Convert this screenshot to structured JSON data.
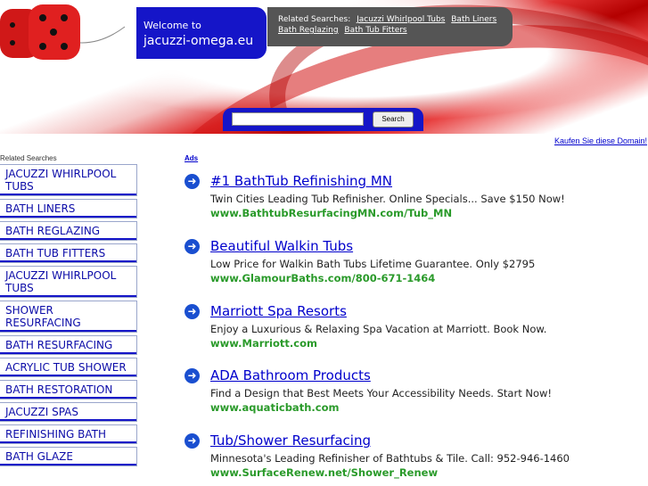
{
  "header": {
    "welcome_label": "Welcome to",
    "domain": "jacuzzi-omega.eu",
    "related_label": "Related Searches:",
    "related_links": [
      "Jacuzzi Whirlpool Tubs",
      "Bath Liners",
      "Bath Reglazing",
      "Bath Tub Fitters"
    ]
  },
  "search": {
    "button_label": "Search",
    "value": ""
  },
  "buy_link": "Kaufen Sie diese Domain!",
  "sidebar": {
    "heading": "Related Searches",
    "items": [
      "JACUZZI WHIRLPOOL TUBS",
      "BATH LINERS",
      "BATH REGLAZING",
      "BATH TUB FITTERS",
      "JACUZZI WHIRLPOOL TUBS",
      "SHOWER RESURFACING",
      "BATH RESURFACING",
      "ACRYLIC TUB SHOWER",
      "BATH RESTORATION",
      "JACUZZI SPAS",
      "REFINISHING BATH",
      "BATH GLAZE"
    ]
  },
  "ads_label": "Ads",
  "ads": [
    {
      "title": "#1 BathTub Refinishing MN",
      "desc": "Twin Cities Leading Tub Refinisher. Online Specials... Save $150 Now!",
      "url": "www.BathtubResurfacingMN.com/Tub_MN"
    },
    {
      "title": "Beautiful Walkin Tubs",
      "desc": "Low Price for Walkin Bath Tubs Lifetime Guarantee. Only $2795",
      "url": "www.GlamourBaths.com/800-671-1464"
    },
    {
      "title": "Marriott Spa Resorts",
      "desc": "Enjoy a Luxurious & Relaxing Spa Vacation at Marriott. Book Now.",
      "url": "www.Marriott.com"
    },
    {
      "title": "ADA Bathroom Products",
      "desc": "Find a Design that Best Meets Your Accessibility Needs. Start Now!",
      "url": "www.aquaticbath.com"
    },
    {
      "title": "Tub/Shower Resurfacing",
      "desc": "Minnesota's Leading Refinisher of Bathtubs & Tile. Call: 952-946-1460",
      "url": "www.SurfaceRenew.net/Shower_Renew"
    }
  ],
  "colors": {
    "accent_blue": "#1515c8",
    "link_blue": "#0000cc",
    "url_green": "#2a9a2a",
    "header_red": "#cc1010"
  },
  "icons": [
    "fuzzy-dice-image",
    "arrow-circle-icon"
  ]
}
